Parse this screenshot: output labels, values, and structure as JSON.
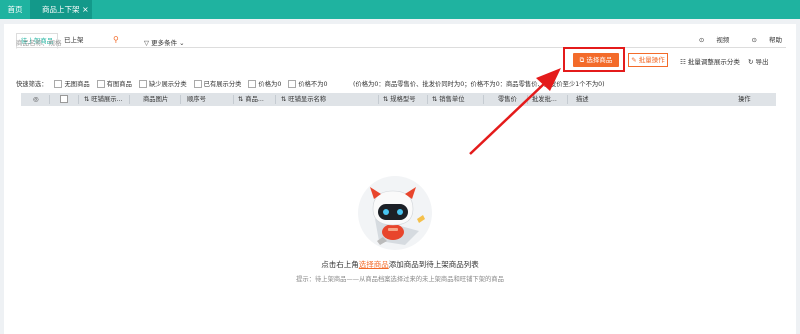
{
  "topbar": {
    "home": "首页",
    "active_tab": "商品上下架",
    "close": "×"
  },
  "subtabs": {
    "pending": "待上架商品",
    "listed": "已上架"
  },
  "rightlinks": {
    "video": "视频",
    "help": "帮助"
  },
  "search": {
    "placeholder": "商品名称、规格"
  },
  "toolbar": {
    "more": "更多条件",
    "select": "选择商品",
    "batch": "批量操作",
    "batch_adjust": "批量调整展示分类",
    "export": "导出"
  },
  "filters": {
    "label": "快速筛选：",
    "items": [
      "无图商品",
      "有图商品",
      "缺少展示分类",
      "已有展示分类",
      "价格为0",
      "价格不为0"
    ]
  },
  "note": "(价格为0：商品零售价、批发价同时为0；价格不为0：商品零售价、批发价至少1个不为0)",
  "table": {
    "columns": [
      "旺铺展示...",
      "商品图片",
      "顺序号",
      "商品...",
      "旺铺显示名称",
      "规格型号",
      "销售单位",
      "零售价",
      "批发批...",
      "描述",
      "操作"
    ]
  },
  "empty": {
    "pre": "点击右上角",
    "link": "选择商品",
    "post": "添加商品到待上架商品列表",
    "hint": "提示：待上架商品——从商品档案选择过来的未上架商品和旺铺下架的商品"
  },
  "colors": {
    "accent": "#1fb3a0",
    "orange": "#f36b2a",
    "highlight": "#e41b1b"
  }
}
